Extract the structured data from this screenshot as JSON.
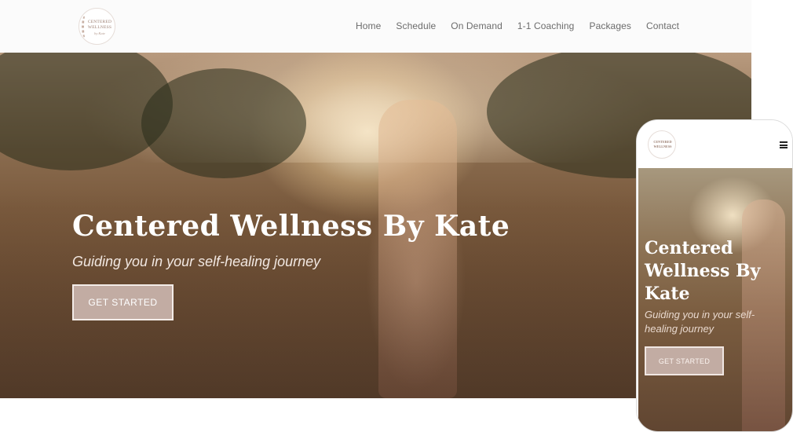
{
  "brand": {
    "logo_line1": "CENTERED",
    "logo_line2": "WELLNESS",
    "logo_line3": "by Kate"
  },
  "nav": {
    "items": [
      "Home",
      "Schedule",
      "On Demand",
      "1-1 Coaching",
      "Packages",
      "Contact"
    ]
  },
  "hero": {
    "title": "Centered Wellness By Kate",
    "subtitle": "Guiding you in your self-healing journey",
    "cta_label": "GET STARTED"
  },
  "mobile": {
    "menu_icon": "hamburger-icon"
  },
  "colors": {
    "accent": "#c2aca3",
    "nav_text": "#6c6c6c",
    "hero_text": "#ffffff"
  }
}
